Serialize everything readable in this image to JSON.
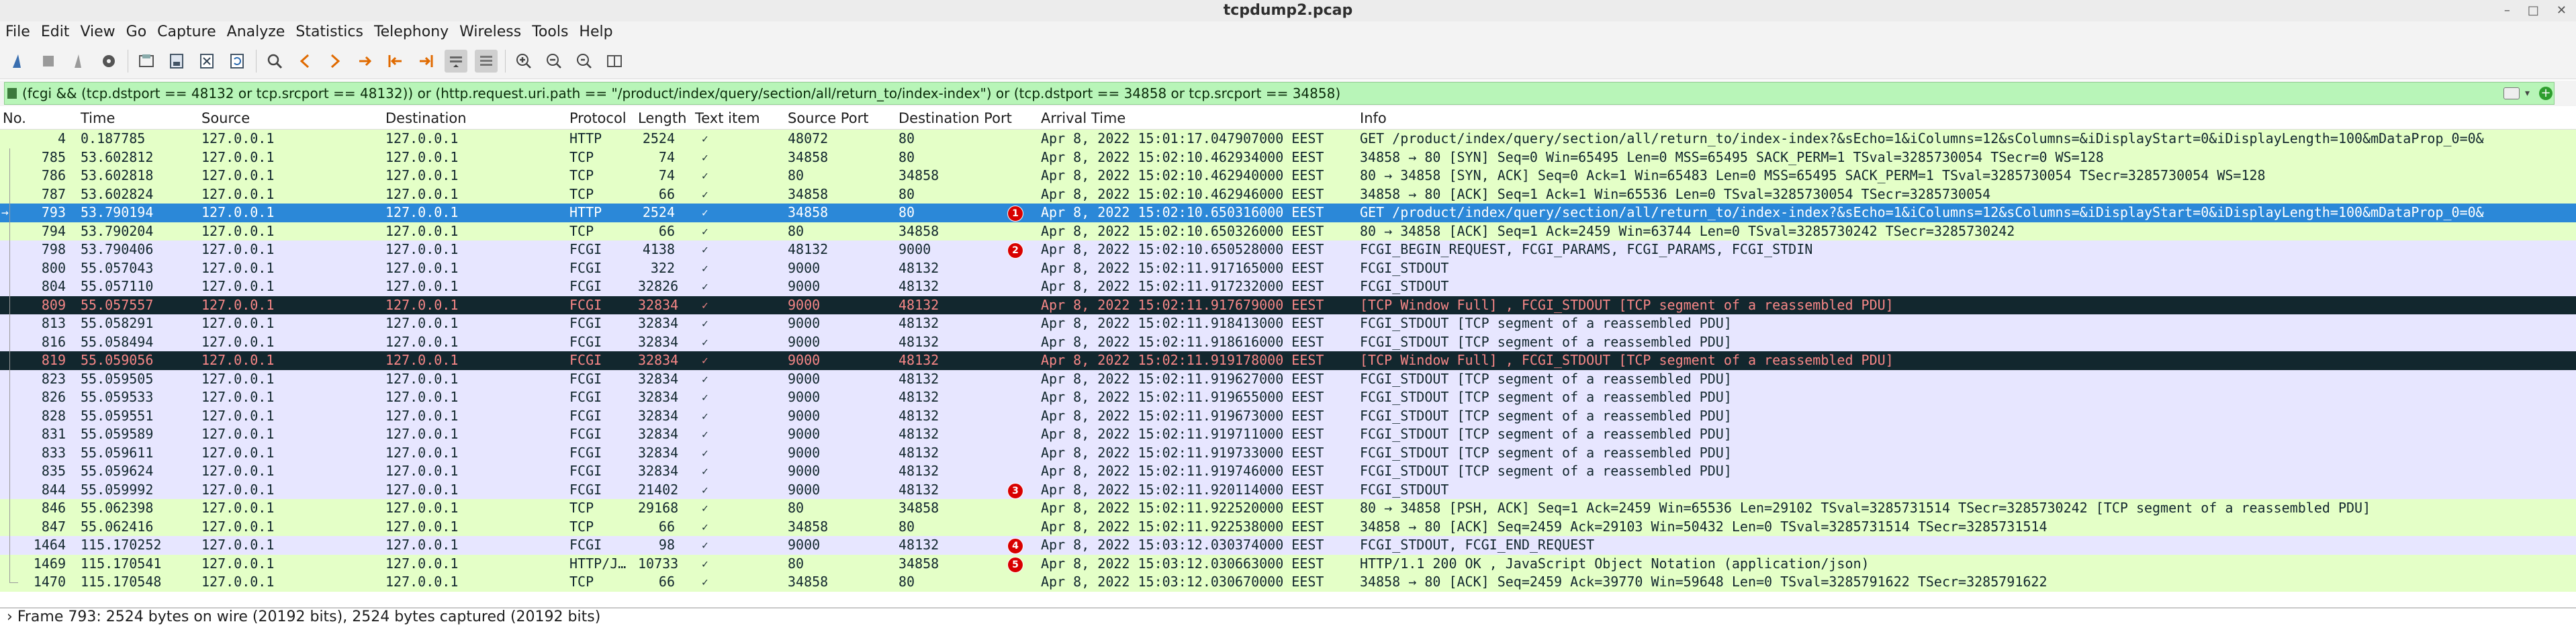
{
  "window": {
    "title": "tcpdump2.pcap",
    "buttons": [
      "–",
      "□",
      "✕"
    ]
  },
  "menu": [
    "File",
    "Edit",
    "View",
    "Go",
    "Capture",
    "Analyze",
    "Statistics",
    "Telephony",
    "Wireless",
    "Tools",
    "Help"
  ],
  "toolbar": [
    "shark-fin-start-icon",
    "stop-capture-icon",
    "restart-capture-icon",
    "capture-options-icon",
    "open-file-icon",
    "save-file-icon",
    "close-file-icon",
    "reload-file-icon",
    "find-packet-icon",
    "go-back-icon",
    "go-forward-icon",
    "go-to-packet-icon",
    "go-first-icon",
    "go-last-icon",
    "auto-scroll-icon",
    "colorize-icon",
    "zoom-in-icon",
    "zoom-out-icon",
    "normal-size-icon",
    "resize-columns-icon"
  ],
  "filter": {
    "text": "(fcgi && (tcp.dstport == 48132 or tcp.srcport == 48132)) or (http.request.uri.path == \"/product/index/query/section/all/return_to/index-index\") or (tcp.dstport == 34858 or tcp.srcport == 34858)"
  },
  "columns": [
    "No.",
    "Time",
    "Source",
    "Destination",
    "Protocol",
    "Length",
    "Text item",
    "Source Port",
    "Destination Port",
    "Arrival Time",
    "Info"
  ],
  "packets": [
    {
      "no": "4",
      "time": "0.187785",
      "src": "127.0.0.1",
      "dst": "127.0.0.1",
      "proto": "HTTP",
      "len": "2524",
      "sport": "48072",
      "dport": "80",
      "arrival": "Apr  8, 2022 15:01:17.047907000 EEST",
      "info": "GET /product/index/query/section/all/return_to/index-index?&sEcho=1&iColumns=12&sColumns=&iDisplayStart=0&iDisplayLength=100&mDataProp_0=0&",
      "kind": "http",
      "badge": ""
    },
    {
      "no": "785",
      "time": "53.602812",
      "src": "127.0.0.1",
      "dst": "127.0.0.1",
      "proto": "TCP",
      "len": "74",
      "sport": "34858",
      "dport": "80",
      "arrival": "Apr  8, 2022 15:02:10.462934000 EEST",
      "info": "34858 → 80 [SYN] Seq=0 Win=65495 Len=0 MSS=65495 SACK_PERM=1 TSval=3285730054 TSecr=0 WS=128",
      "kind": "http",
      "badge": ""
    },
    {
      "no": "786",
      "time": "53.602818",
      "src": "127.0.0.1",
      "dst": "127.0.0.1",
      "proto": "TCP",
      "len": "74",
      "sport": "80",
      "dport": "34858",
      "arrival": "Apr  8, 2022 15:02:10.462940000 EEST",
      "info": "80 → 34858 [SYN, ACK] Seq=0 Ack=1 Win=65483 Len=0 MSS=65495 SACK_PERM=1 TSval=3285730054 TSecr=3285730054 WS=128",
      "kind": "http",
      "badge": ""
    },
    {
      "no": "787",
      "time": "53.602824",
      "src": "127.0.0.1",
      "dst": "127.0.0.1",
      "proto": "TCP",
      "len": "66",
      "sport": "34858",
      "dport": "80",
      "arrival": "Apr  8, 2022 15:02:10.462946000 EEST",
      "info": "34858 → 80 [ACK] Seq=1 Ack=1 Win=65536 Len=0 TSval=3285730054 TSecr=3285730054",
      "kind": "http",
      "badge": ""
    },
    {
      "no": "793",
      "time": "53.790194",
      "src": "127.0.0.1",
      "dst": "127.0.0.1",
      "proto": "HTTP",
      "len": "2524",
      "sport": "34858",
      "dport": "80",
      "arrival": "Apr  8, 2022 15:02:10.650316000 EEST",
      "info": "GET /product/index/query/section/all/return_to/index-index?&sEcho=1&iColumns=12&sColumns=&iDisplayStart=0&iDisplayLength=100&mDataProp_0=0&",
      "kind": "sel",
      "badge": "1"
    },
    {
      "no": "794",
      "time": "53.790204",
      "src": "127.0.0.1",
      "dst": "127.0.0.1",
      "proto": "TCP",
      "len": "66",
      "sport": "80",
      "dport": "34858",
      "arrival": "Apr  8, 2022 15:02:10.650326000 EEST",
      "info": "80 → 34858 [ACK] Seq=1 Ack=2459 Win=63744 Len=0 TSval=3285730242 TSecr=3285730242",
      "kind": "http",
      "badge": ""
    },
    {
      "no": "798",
      "time": "53.790406",
      "src": "127.0.0.1",
      "dst": "127.0.0.1",
      "proto": "FCGI",
      "len": "4138",
      "sport": "48132",
      "dport": "9000",
      "arrival": "Apr  8, 2022 15:02:10.650528000 EEST",
      "info": "FCGI_BEGIN_REQUEST, FCGI_PARAMS, FCGI_PARAMS, FCGI_STDIN",
      "kind": "fcgi",
      "badge": "2"
    },
    {
      "no": "800",
      "time": "55.057043",
      "src": "127.0.0.1",
      "dst": "127.0.0.1",
      "proto": "FCGI",
      "len": "322",
      "sport": "9000",
      "dport": "48132",
      "arrival": "Apr  8, 2022 15:02:11.917165000 EEST",
      "info": "FCGI_STDOUT",
      "kind": "fcgi",
      "badge": ""
    },
    {
      "no": "804",
      "time": "55.057110",
      "src": "127.0.0.1",
      "dst": "127.0.0.1",
      "proto": "FCGI",
      "len": "32826",
      "sport": "9000",
      "dport": "48132",
      "arrival": "Apr  8, 2022 15:02:11.917232000 EEST",
      "info": "FCGI_STDOUT",
      "kind": "fcgi",
      "badge": ""
    },
    {
      "no": "809",
      "time": "55.057557",
      "src": "127.0.0.1",
      "dst": "127.0.0.1",
      "proto": "FCGI",
      "len": "32834",
      "sport": "9000",
      "dport": "48132",
      "arrival": "Apr  8, 2022 15:02:11.917679000 EEST",
      "info": "[TCP Window Full] , FCGI_STDOUT [TCP segment of a reassembled PDU]",
      "kind": "bad",
      "badge": ""
    },
    {
      "no": "813",
      "time": "55.058291",
      "src": "127.0.0.1",
      "dst": "127.0.0.1",
      "proto": "FCGI",
      "len": "32834",
      "sport": "9000",
      "dport": "48132",
      "arrival": "Apr  8, 2022 15:02:11.918413000 EEST",
      "info": "FCGI_STDOUT [TCP segment of a reassembled PDU]",
      "kind": "fcgi",
      "badge": ""
    },
    {
      "no": "816",
      "time": "55.058494",
      "src": "127.0.0.1",
      "dst": "127.0.0.1",
      "proto": "FCGI",
      "len": "32834",
      "sport": "9000",
      "dport": "48132",
      "arrival": "Apr  8, 2022 15:02:11.918616000 EEST",
      "info": "FCGI_STDOUT [TCP segment of a reassembled PDU]",
      "kind": "fcgi",
      "badge": ""
    },
    {
      "no": "819",
      "time": "55.059056",
      "src": "127.0.0.1",
      "dst": "127.0.0.1",
      "proto": "FCGI",
      "len": "32834",
      "sport": "9000",
      "dport": "48132",
      "arrival": "Apr  8, 2022 15:02:11.919178000 EEST",
      "info": "[TCP Window Full] , FCGI_STDOUT [TCP segment of a reassembled PDU]",
      "kind": "bad",
      "badge": ""
    },
    {
      "no": "823",
      "time": "55.059505",
      "src": "127.0.0.1",
      "dst": "127.0.0.1",
      "proto": "FCGI",
      "len": "32834",
      "sport": "9000",
      "dport": "48132",
      "arrival": "Apr  8, 2022 15:02:11.919627000 EEST",
      "info": "FCGI_STDOUT [TCP segment of a reassembled PDU]",
      "kind": "fcgi",
      "badge": ""
    },
    {
      "no": "826",
      "time": "55.059533",
      "src": "127.0.0.1",
      "dst": "127.0.0.1",
      "proto": "FCGI",
      "len": "32834",
      "sport": "9000",
      "dport": "48132",
      "arrival": "Apr  8, 2022 15:02:11.919655000 EEST",
      "info": "FCGI_STDOUT [TCP segment of a reassembled PDU]",
      "kind": "fcgi",
      "badge": ""
    },
    {
      "no": "828",
      "time": "55.059551",
      "src": "127.0.0.1",
      "dst": "127.0.0.1",
      "proto": "FCGI",
      "len": "32834",
      "sport": "9000",
      "dport": "48132",
      "arrival": "Apr  8, 2022 15:02:11.919673000 EEST",
      "info": "FCGI_STDOUT [TCP segment of a reassembled PDU]",
      "kind": "fcgi",
      "badge": ""
    },
    {
      "no": "831",
      "time": "55.059589",
      "src": "127.0.0.1",
      "dst": "127.0.0.1",
      "proto": "FCGI",
      "len": "32834",
      "sport": "9000",
      "dport": "48132",
      "arrival": "Apr  8, 2022 15:02:11.919711000 EEST",
      "info": "FCGI_STDOUT [TCP segment of a reassembled PDU]",
      "kind": "fcgi",
      "badge": ""
    },
    {
      "no": "833",
      "time": "55.059611",
      "src": "127.0.0.1",
      "dst": "127.0.0.1",
      "proto": "FCGI",
      "len": "32834",
      "sport": "9000",
      "dport": "48132",
      "arrival": "Apr  8, 2022 15:02:11.919733000 EEST",
      "info": "FCGI_STDOUT [TCP segment of a reassembled PDU]",
      "kind": "fcgi",
      "badge": ""
    },
    {
      "no": "835",
      "time": "55.059624",
      "src": "127.0.0.1",
      "dst": "127.0.0.1",
      "proto": "FCGI",
      "len": "32834",
      "sport": "9000",
      "dport": "48132",
      "arrival": "Apr  8, 2022 15:02:11.919746000 EEST",
      "info": "FCGI_STDOUT [TCP segment of a reassembled PDU]",
      "kind": "fcgi",
      "badge": ""
    },
    {
      "no": "844",
      "time": "55.059992",
      "src": "127.0.0.1",
      "dst": "127.0.0.1",
      "proto": "FCGI",
      "len": "21402",
      "sport": "9000",
      "dport": "48132",
      "arrival": "Apr  8, 2022 15:02:11.920114000 EEST",
      "info": "FCGI_STDOUT",
      "kind": "fcgi",
      "badge": "3"
    },
    {
      "no": "846",
      "time": "55.062398",
      "src": "127.0.0.1",
      "dst": "127.0.0.1",
      "proto": "TCP",
      "len": "29168",
      "sport": "80",
      "dport": "34858",
      "arrival": "Apr  8, 2022 15:02:11.922520000 EEST",
      "info": "80 → 34858 [PSH, ACK] Seq=1 Ack=2459 Win=65536 Len=29102 TSval=3285731514 TSecr=3285730242 [TCP segment of a reassembled PDU]",
      "kind": "http",
      "badge": ""
    },
    {
      "no": "847",
      "time": "55.062416",
      "src": "127.0.0.1",
      "dst": "127.0.0.1",
      "proto": "TCP",
      "len": "66",
      "sport": "34858",
      "dport": "80",
      "arrival": "Apr  8, 2022 15:02:11.922538000 EEST",
      "info": "34858 → 80 [ACK] Seq=2459 Ack=29103 Win=50432 Len=0 TSval=3285731514 TSecr=3285731514",
      "kind": "http",
      "badge": ""
    },
    {
      "no": "1464",
      "time": "115.170252",
      "src": "127.0.0.1",
      "dst": "127.0.0.1",
      "proto": "FCGI",
      "len": "98",
      "sport": "9000",
      "dport": "48132",
      "arrival": "Apr  8, 2022 15:03:12.030374000 EEST",
      "info": "FCGI_STDOUT, FCGI_END_REQUEST",
      "kind": "fcgi",
      "badge": "4"
    },
    {
      "no": "1469",
      "time": "115.170541",
      "src": "127.0.0.1",
      "dst": "127.0.0.1",
      "proto": "HTTP/J…",
      "len": "10733",
      "sport": "80",
      "dport": "34858",
      "arrival": "Apr  8, 2022 15:03:12.030663000 EEST",
      "info": "HTTP/1.1 200 OK , JavaScript Object Notation (application/json)",
      "kind": "http",
      "badge": "5"
    },
    {
      "no": "1470",
      "time": "115.170548",
      "src": "127.0.0.1",
      "dst": "127.0.0.1",
      "proto": "TCP",
      "len": "66",
      "sport": "34858",
      "dport": "80",
      "arrival": "Apr  8, 2022 15:03:12.030670000 EEST",
      "info": "34858 → 80 [ACK] Seq=2459 Ack=39770 Win=59648 Len=0 TSval=3285791622 TSecr=3285791622",
      "kind": "http",
      "badge": ""
    }
  ],
  "detail": "Frame 793: 2524 bytes on wire (20192 bits), 2524 bytes captured (20192 bits)"
}
